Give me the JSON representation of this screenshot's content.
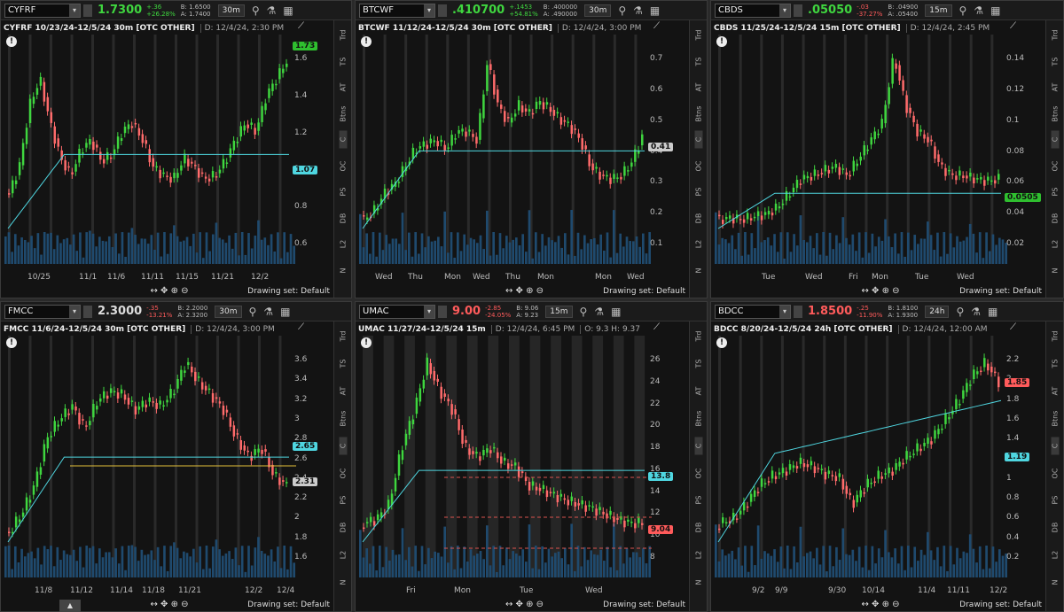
{
  "sidebar_items": [
    "Trd",
    "TS",
    "AT",
    "Btns",
    "C",
    "OC",
    "PS",
    "DB",
    "L2",
    "N"
  ],
  "drawing_set": "Drawing set: Default",
  "panels": [
    {
      "id": "cyfrf",
      "symbol": "CYFRF",
      "price": "1.7300",
      "dir": "up",
      "chg1": "+.36",
      "chg2": "+26.28%",
      "bid": "B: 1.6500",
      "ask": "A: 1.7400",
      "tf": "30m",
      "title": "CYFRF 10/23/24-12/5/24 30m [OTC OTHER]",
      "date": "D: 12/4/24, 2:30 PM",
      "extra": "",
      "yticks": [
        "1.6",
        "1.4",
        "1.2",
        "1",
        "0.8",
        "0.6"
      ],
      "xticks": [
        "10/25",
        "11/1",
        "11/6",
        "11/11",
        "11/15",
        "11/21",
        "12/2"
      ],
      "last_badge": "1.73",
      "ma_badge": "1.07",
      "last_color": "#2fbf2f",
      "ma_color": "#4fd6e0"
    },
    {
      "id": "btcwf",
      "symbol": "BTCWF",
      "price": ".410700",
      "dir": "up",
      "chg1": "+.1453",
      "chg2": "+54.81%",
      "bid": "B: .400000",
      "ask": "A: .490000",
      "tf": "30m",
      "title": "BTCWF 11/12/24-12/5/24 30m [OTC OTHER]",
      "date": "D: 12/4/24, 3:00 PM",
      "extra": "",
      "yticks": [
        "0.7",
        "0.6",
        "0.5",
        "0.4",
        "0.3",
        "0.2",
        "0.1"
      ],
      "xticks": [
        "Wed",
        "Thu",
        "Mon",
        "Wed",
        "Thu",
        "Mon",
        "Mon",
        "Wed"
      ],
      "last_badge": "0.41",
      "ma_badge": "",
      "last_color": "#cccccc",
      "ma_color": "#4fd6e0"
    },
    {
      "id": "cbds",
      "symbol": "CBDS",
      "price": ".05050",
      "dir": "up",
      "chg1": "-.03",
      "chg2": "-37.27%",
      "bid": "B: .04900",
      "ask": "A: .05400",
      "tf": "15m",
      "title": "CBDS 11/25/24-12/5/24 15m [OTC OTHER]",
      "date": "D: 12/4/24, 2:45 PM",
      "extra": "",
      "yticks": [
        "0.14",
        "0.12",
        "0.1",
        "0.08",
        "0.06",
        "0.04",
        "0.02"
      ],
      "xticks": [
        "Tue",
        "Wed",
        "Fri",
        "Mon",
        "Tue",
        "Wed"
      ],
      "last_badge": "0.0505",
      "ma_badge": "",
      "last_color": "#2fbf2f",
      "ma_color": "#4fd6e0"
    },
    {
      "id": "fmcc",
      "symbol": "FMCC",
      "price": "2.3000",
      "dir": "none",
      "chg1": "-.35",
      "chg2": "-13.21%",
      "bid": "B: 2.2000",
      "ask": "A: 2.3200",
      "tf": "30m",
      "title": "FMCC 11/6/24-12/5/24 30m [OTC OTHER]",
      "date": "D: 12/4/24, 3:00 PM",
      "extra": "",
      "yticks": [
        "3.6",
        "3.4",
        "3.2",
        "3",
        "2.8",
        "2.6",
        "2.4",
        "2.2",
        "2",
        "1.8",
        "1.6"
      ],
      "xticks": [
        "11/8",
        "11/12",
        "11/14",
        "11/18",
        "11/21",
        "12/2",
        "12/4"
      ],
      "last_badge": "2.31",
      "ma_badge": "2.65",
      "last_color": "#cccccc",
      "ma_color": "#4fd6e0"
    },
    {
      "id": "umac",
      "symbol": "UMAC",
      "price": "9.00",
      "dir": "dn",
      "chg1": "-2.85",
      "chg2": "-24.05%",
      "bid": "B: 9.06",
      "ask": "A: 9.23",
      "tf": "15m",
      "title": "UMAC 11/27/24-12/5/24 15m",
      "date": "D: 12/4/24, 6:45 PM",
      "extra": "O: 9.3   H: 9.37",
      "yticks": [
        "26",
        "24",
        "22",
        "20",
        "18",
        "16",
        "14",
        "12",
        "10",
        "8"
      ],
      "xticks": [
        "Fri",
        "Mon",
        "Tue",
        "Wed"
      ],
      "last_badge": "9.04",
      "ma_badge": "13.8",
      "last_color": "#ff5b5b",
      "ma_color": "#4fd6e0"
    },
    {
      "id": "bdcc",
      "symbol": "BDCC",
      "price": "1.8500",
      "dir": "dn",
      "chg1": "-.25",
      "chg2": "-11.90%",
      "bid": "B: 1.8100",
      "ask": "A: 1.9300",
      "tf": "24h",
      "title": "BDCC 8/20/24-12/5/24 24h [OTC OTHER]",
      "date": "D: 12/4/24, 12:00 AM",
      "extra": "",
      "yticks": [
        "2.2",
        "2",
        "1.8",
        "1.6",
        "1.4",
        "1.2",
        "1",
        "0.8",
        "0.6",
        "0.4",
        "0.2"
      ],
      "xticks": [
        "9/2",
        "9/9",
        "9/30",
        "10/14",
        "11/4",
        "11/11",
        "12/2"
      ],
      "last_badge": "1.85",
      "ma_badge": "1.19",
      "last_color": "#ff5b5b",
      "ma_color": "#4fd6e0"
    }
  ]
}
